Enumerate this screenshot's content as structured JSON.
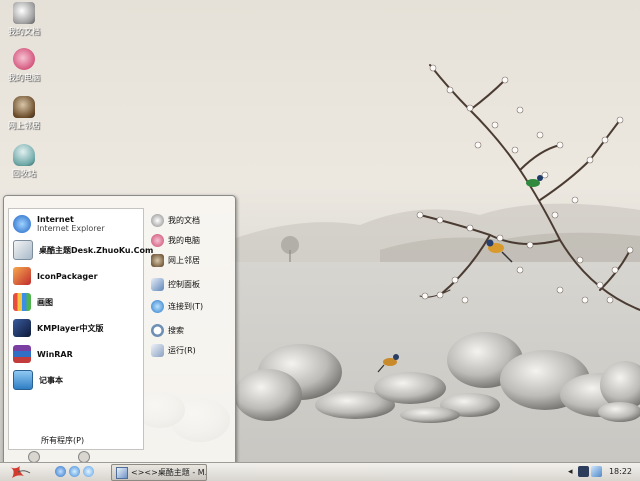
{
  "desktop": {
    "icons": [
      {
        "label": "我的文档",
        "icon": "my-documents-icon"
      },
      {
        "label": "我的电脑",
        "icon": "my-computer-icon"
      },
      {
        "label": "网上邻居",
        "icon": "network-places-icon"
      },
      {
        "label": "回收站",
        "icon": "recycle-bin-icon"
      }
    ]
  },
  "startmenu": {
    "left_items": [
      {
        "title": "Internet",
        "subtitle": "Internet Explorer",
        "icon": "internet-explorer-icon"
      },
      {
        "title": "桌酷主题Desk.ZhuoKu.Com",
        "icon": "zhuoku-icon"
      },
      {
        "title": "IconPackager",
        "icon": "iconpackager-icon"
      },
      {
        "title": "画图",
        "icon": "paint-icon"
      },
      {
        "title": "KMPlayer中文版",
        "icon": "kmplayer-icon"
      },
      {
        "title": "WinRAR",
        "icon": "winrar-icon"
      },
      {
        "title": "记事本",
        "icon": "notepad-icon"
      }
    ],
    "all_programs": "所有程序(P)",
    "right_items": [
      {
        "label": "我的文档",
        "icon": "my-documents-icon"
      },
      {
        "label": "我的电脑",
        "icon": "my-computer-icon"
      },
      {
        "label": "网上邻居",
        "icon": "network-places-icon"
      },
      {
        "label": "控制面板",
        "icon": "control-panel-icon"
      },
      {
        "label": "连接到(T)",
        "icon": "connect-to-icon"
      },
      {
        "label": "搜索",
        "icon": "search-icon"
      },
      {
        "label": "运行(R)",
        "icon": "run-icon"
      }
    ]
  },
  "taskbar": {
    "task_label": "<><>桌酷主题 - M...",
    "clock": "18:22"
  }
}
